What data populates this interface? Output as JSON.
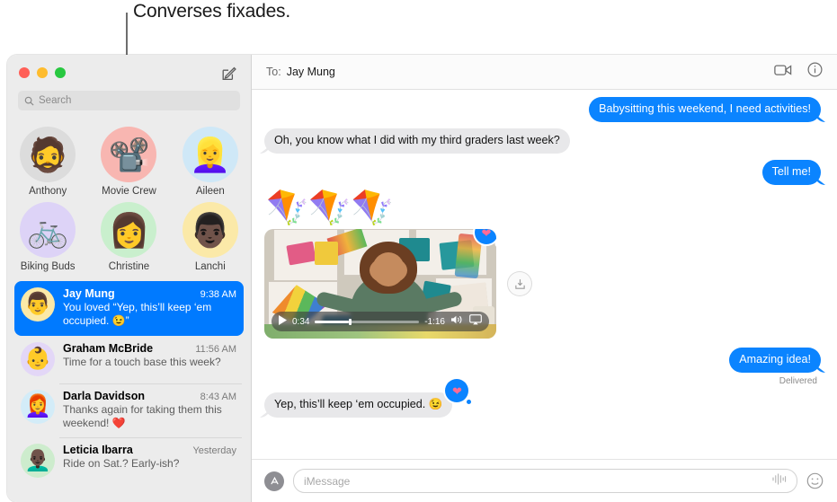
{
  "annotation": {
    "label": "Converses fixades."
  },
  "window": {
    "traffic_lights": [
      "close",
      "minimize",
      "zoom"
    ],
    "compose_icon": "compose-pencil-icon"
  },
  "sidebar": {
    "search": {
      "placeholder": "Search",
      "icon": "search-icon"
    },
    "pinned": [
      {
        "name": "Anthony",
        "emoji": "🧔",
        "bg": "#dcdcdc"
      },
      {
        "name": "Movie Crew",
        "emoji": "📽️",
        "bg": "#f8b6b1"
      },
      {
        "name": "Aileen",
        "emoji": "👱‍♀️",
        "bg": "#cfe8f7"
      },
      {
        "name": "Biking Buds",
        "emoji": "🚲",
        "bg": "#ddd3f7"
      },
      {
        "name": "Christine",
        "emoji": "👩",
        "bg": "#c9efcd"
      },
      {
        "name": "Lanchi",
        "emoji": "👨🏿",
        "bg": "#fbe9a8"
      }
    ],
    "conversations": [
      {
        "name": "Jay Mung",
        "time": "9:38 AM",
        "snippet": "You loved “Yep, this’ll keep ‘em occupied. 😉”",
        "emoji": "👨",
        "bg": "#fbe9a8",
        "selected": true
      },
      {
        "name": "Graham McBride",
        "time": "11:56 AM",
        "snippet": "Time for a touch base this week?",
        "emoji": "👶",
        "bg": "#e3d7f7",
        "selected": false
      },
      {
        "name": "Darla Davidson",
        "time": "8:43 AM",
        "snippet": "Thanks again for taking them this weekend! ❤️",
        "emoji": "👩‍🦰",
        "bg": "#d3ecf8",
        "selected": false
      },
      {
        "name": "Leticia Ibarra",
        "time": "Yesterday",
        "snippet": "Ride on Sat.? Early-ish?",
        "emoji": "👨🏿‍🦲",
        "bg": "#cdeccd",
        "selected": false
      }
    ]
  },
  "pane": {
    "header": {
      "to_label": "To:",
      "recipient": "Jay Mung",
      "facetime_icon": "video-camera-icon",
      "info_icon": "info-circle-icon"
    },
    "messages": [
      {
        "type": "text",
        "side": "out",
        "text": "Babysitting this weekend, I need activities!"
      },
      {
        "type": "text",
        "side": "in",
        "text": "Oh, you know what I did with my third graders last week?"
      },
      {
        "type": "text",
        "side": "out",
        "text": "Tell me!"
      },
      {
        "type": "emoji",
        "side": "in",
        "text": "🪁🪁🪁"
      },
      {
        "type": "video",
        "side": "in",
        "reaction": "heart"
      },
      {
        "type": "text",
        "side": "out",
        "text": "Amazing idea!",
        "status": "Delivered"
      },
      {
        "type": "text",
        "side": "in",
        "text": "Yep, this’ll keep ‘em occupied. 😉",
        "reaction": "heart"
      }
    ],
    "video": {
      "elapsed": "0:34",
      "remaining": "-1:16",
      "progress_percent": 32,
      "play_icon": "play-icon",
      "volume_icon": "volume-icon",
      "airplay_icon": "airplay-icon",
      "download_icon": "download-icon"
    },
    "input": {
      "appstore_icon": "appstore-icon",
      "placeholder": "iMessage",
      "audio_icon": "audio-waveform-icon",
      "emoji_icon": "emoji-smiley-icon"
    }
  },
  "colors": {
    "accent_blue": "#0b84ff",
    "selected_row": "#007aff",
    "incoming_bubble": "#e8e8ea",
    "sidebar_bg": "#ececec",
    "reaction_heart": "#ff6b96"
  }
}
